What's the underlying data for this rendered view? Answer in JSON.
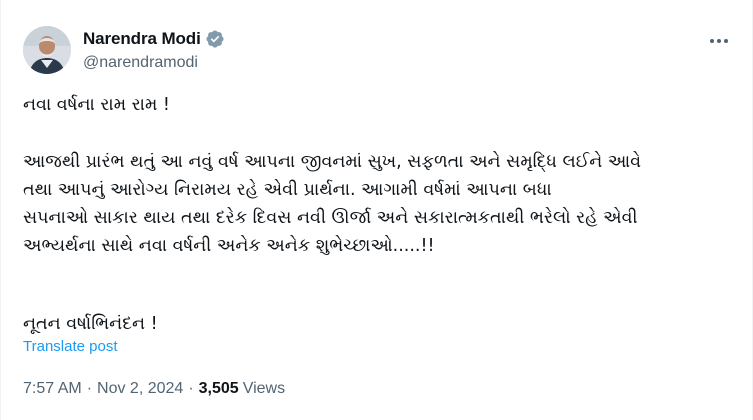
{
  "author": {
    "display_name": "Narendra Modi",
    "handle": "@narendramodi",
    "verified": true
  },
  "post": {
    "greeting": "નવા વર્ષના રામ રામ !",
    "body_lines": [
      "આજથી પ્રારંભ થતું આ નવું વર્ષ આપના જીવનમાં સુખ, સફળતા અને સમૃદ્ધિ લઈને આવે",
      "તથા આપનું આરોગ્ય નિરામય રહે એવી પ્રાર્થના. આગામી વર્ષમાં આપના બધા",
      "સપનાઓ સાકાર થાય તથા દરેક દિવસ નવી ઊર્જા અને સકારાત્મકતાથી ભરેલો રહે એવી",
      "અભ્યર્થના સાથે નવા વર્ષની અનેક અનેક શુભેચ્છાઓ.....!!"
    ],
    "closing": "નૂતન વર્ષાભિનંદન !"
  },
  "translate_label": "Translate post",
  "meta": {
    "time": "7:57 AM",
    "separator": "·",
    "date": "Nov 2, 2024",
    "views_count": "3,505",
    "views_label": "Views"
  },
  "icons": {
    "verified": "verified-badge-icon",
    "more": "more-options-icon"
  },
  "colors": {
    "accent": "#1d9bf0",
    "secondary_text": "#536471",
    "primary_text": "#0f1419"
  }
}
